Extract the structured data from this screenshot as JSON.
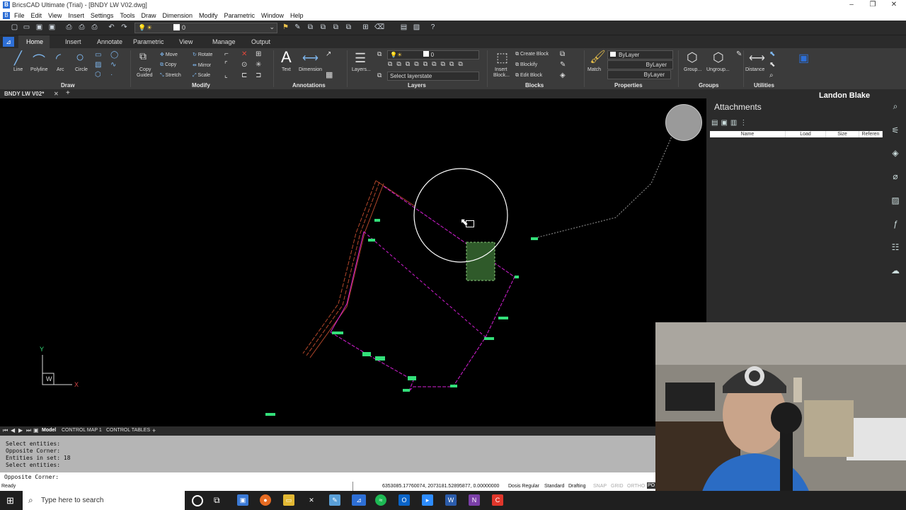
{
  "window": {
    "title": "BricsCAD Ultimate (Trial) - [BNDY LW V02.dwg]",
    "logo_letter": "B"
  },
  "menu": [
    "File",
    "Edit",
    "View",
    "Insert",
    "Settings",
    "Tools",
    "Draw",
    "Dimension",
    "Modify",
    "Parametric",
    "Window",
    "Help"
  ],
  "quick_access": {
    "layer_value": "0"
  },
  "ribbon_tabs": [
    "Home",
    "Insert",
    "Annotate",
    "Parametric",
    "View",
    "Manage",
    "Output"
  ],
  "ribbon": {
    "draw": {
      "label": "Draw",
      "tools": [
        "Line",
        "Polyline",
        "Arc",
        "Circle"
      ]
    },
    "modify": {
      "label": "Modify",
      "copy_guided": [
        "Copy",
        "Guided"
      ],
      "tools": [
        "Move",
        "Copy",
        "Stretch",
        "Rotate",
        "Mirror",
        "Scale"
      ]
    },
    "annotations": {
      "label": "Annotations",
      "tools": [
        "Text",
        "Dimension"
      ]
    },
    "layers": {
      "label": "Layers",
      "tool": "Layers...",
      "layer_value": "0",
      "layerstate": "Select layerstate"
    },
    "blocks": {
      "label": "Blocks",
      "insert": [
        "Insert",
        "Block..."
      ],
      "tools": [
        "Create Block",
        "Blockify",
        "Edit Block"
      ]
    },
    "properties": {
      "label": "Properties",
      "match": "Match",
      "dd": [
        "ByLayer",
        "ByLayer",
        "ByLayer"
      ]
    },
    "groups": {
      "label": "Groups",
      "tools": [
        "Group...",
        "Ungroup..."
      ]
    },
    "utilities": {
      "label": "Utilities",
      "tool": "Distance"
    }
  },
  "document_tab": "BNDY LW V02*",
  "user_name": "Landon Blake",
  "attachments": {
    "title": "Attachments",
    "columns": [
      "Name",
      "Load",
      "Size",
      "Referen"
    ]
  },
  "ucs": {
    "y": "Y",
    "x": "X",
    "w": "W"
  },
  "layout_tabs": [
    "Model",
    "CONTROL MAP 1",
    "CONTROL TABLES",
    "+"
  ],
  "command_history": [
    "Select entities:",
    "Opposite Corner:",
    "Entities in set: 18",
    "Select entities:"
  ],
  "command_prompt": "Opposite Corner:",
  "status": {
    "left": "Ready",
    "coords": "6353085.17760074, 2073181.52895877, 0.00000000",
    "items": [
      "Dosis Regular",
      "Standard",
      "Drafting",
      "SNAP",
      "GRID",
      "ORTHO",
      "PO"
    ]
  },
  "taskbar": {
    "search_placeholder": "Type here to search"
  },
  "colors": {
    "accent": "#2d6fd6",
    "selection": "#2f5a2a",
    "survey_point": "#33e07a",
    "boundary": "#d61fd6",
    "offset_line": "#b3472b"
  }
}
